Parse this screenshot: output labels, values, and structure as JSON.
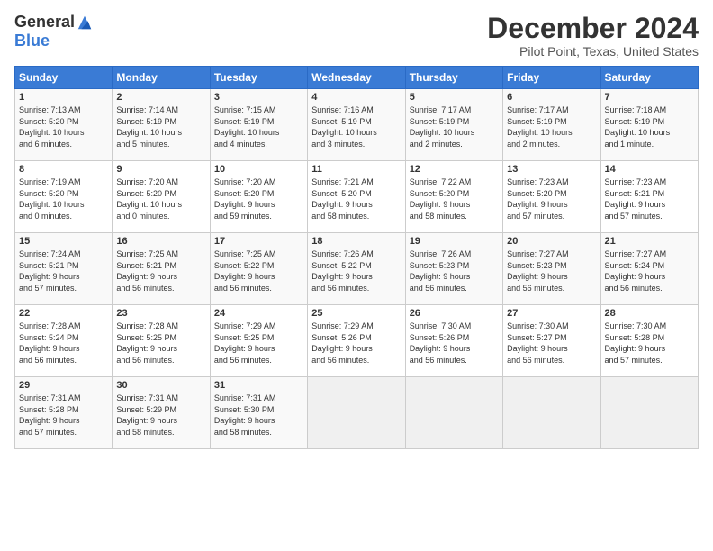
{
  "logo": {
    "general": "General",
    "blue": "Blue"
  },
  "header": {
    "month": "December 2024",
    "location": "Pilot Point, Texas, United States"
  },
  "weekdays": [
    "Sunday",
    "Monday",
    "Tuesday",
    "Wednesday",
    "Thursday",
    "Friday",
    "Saturday"
  ],
  "weeks": [
    [
      {
        "day": "1",
        "info": "Sunrise: 7:13 AM\nSunset: 5:20 PM\nDaylight: 10 hours\nand 6 minutes."
      },
      {
        "day": "2",
        "info": "Sunrise: 7:14 AM\nSunset: 5:19 PM\nDaylight: 10 hours\nand 5 minutes."
      },
      {
        "day": "3",
        "info": "Sunrise: 7:15 AM\nSunset: 5:19 PM\nDaylight: 10 hours\nand 4 minutes."
      },
      {
        "day": "4",
        "info": "Sunrise: 7:16 AM\nSunset: 5:19 PM\nDaylight: 10 hours\nand 3 minutes."
      },
      {
        "day": "5",
        "info": "Sunrise: 7:17 AM\nSunset: 5:19 PM\nDaylight: 10 hours\nand 2 minutes."
      },
      {
        "day": "6",
        "info": "Sunrise: 7:17 AM\nSunset: 5:19 PM\nDaylight: 10 hours\nand 2 minutes."
      },
      {
        "day": "7",
        "info": "Sunrise: 7:18 AM\nSunset: 5:19 PM\nDaylight: 10 hours\nand 1 minute."
      }
    ],
    [
      {
        "day": "8",
        "info": "Sunrise: 7:19 AM\nSunset: 5:20 PM\nDaylight: 10 hours\nand 0 minutes."
      },
      {
        "day": "9",
        "info": "Sunrise: 7:20 AM\nSunset: 5:20 PM\nDaylight: 10 hours\nand 0 minutes."
      },
      {
        "day": "10",
        "info": "Sunrise: 7:20 AM\nSunset: 5:20 PM\nDaylight: 9 hours\nand 59 minutes."
      },
      {
        "day": "11",
        "info": "Sunrise: 7:21 AM\nSunset: 5:20 PM\nDaylight: 9 hours\nand 58 minutes."
      },
      {
        "day": "12",
        "info": "Sunrise: 7:22 AM\nSunset: 5:20 PM\nDaylight: 9 hours\nand 58 minutes."
      },
      {
        "day": "13",
        "info": "Sunrise: 7:23 AM\nSunset: 5:20 PM\nDaylight: 9 hours\nand 57 minutes."
      },
      {
        "day": "14",
        "info": "Sunrise: 7:23 AM\nSunset: 5:21 PM\nDaylight: 9 hours\nand 57 minutes."
      }
    ],
    [
      {
        "day": "15",
        "info": "Sunrise: 7:24 AM\nSunset: 5:21 PM\nDaylight: 9 hours\nand 57 minutes."
      },
      {
        "day": "16",
        "info": "Sunrise: 7:25 AM\nSunset: 5:21 PM\nDaylight: 9 hours\nand 56 minutes."
      },
      {
        "day": "17",
        "info": "Sunrise: 7:25 AM\nSunset: 5:22 PM\nDaylight: 9 hours\nand 56 minutes."
      },
      {
        "day": "18",
        "info": "Sunrise: 7:26 AM\nSunset: 5:22 PM\nDaylight: 9 hours\nand 56 minutes."
      },
      {
        "day": "19",
        "info": "Sunrise: 7:26 AM\nSunset: 5:23 PM\nDaylight: 9 hours\nand 56 minutes."
      },
      {
        "day": "20",
        "info": "Sunrise: 7:27 AM\nSunset: 5:23 PM\nDaylight: 9 hours\nand 56 minutes."
      },
      {
        "day": "21",
        "info": "Sunrise: 7:27 AM\nSunset: 5:24 PM\nDaylight: 9 hours\nand 56 minutes."
      }
    ],
    [
      {
        "day": "22",
        "info": "Sunrise: 7:28 AM\nSunset: 5:24 PM\nDaylight: 9 hours\nand 56 minutes."
      },
      {
        "day": "23",
        "info": "Sunrise: 7:28 AM\nSunset: 5:25 PM\nDaylight: 9 hours\nand 56 minutes."
      },
      {
        "day": "24",
        "info": "Sunrise: 7:29 AM\nSunset: 5:25 PM\nDaylight: 9 hours\nand 56 minutes."
      },
      {
        "day": "25",
        "info": "Sunrise: 7:29 AM\nSunset: 5:26 PM\nDaylight: 9 hours\nand 56 minutes."
      },
      {
        "day": "26",
        "info": "Sunrise: 7:30 AM\nSunset: 5:26 PM\nDaylight: 9 hours\nand 56 minutes."
      },
      {
        "day": "27",
        "info": "Sunrise: 7:30 AM\nSunset: 5:27 PM\nDaylight: 9 hours\nand 56 minutes."
      },
      {
        "day": "28",
        "info": "Sunrise: 7:30 AM\nSunset: 5:28 PM\nDaylight: 9 hours\nand 57 minutes."
      }
    ],
    [
      {
        "day": "29",
        "info": "Sunrise: 7:31 AM\nSunset: 5:28 PM\nDaylight: 9 hours\nand 57 minutes."
      },
      {
        "day": "30",
        "info": "Sunrise: 7:31 AM\nSunset: 5:29 PM\nDaylight: 9 hours\nand 58 minutes."
      },
      {
        "day": "31",
        "info": "Sunrise: 7:31 AM\nSunset: 5:30 PM\nDaylight: 9 hours\nand 58 minutes."
      },
      {
        "day": "",
        "info": ""
      },
      {
        "day": "",
        "info": ""
      },
      {
        "day": "",
        "info": ""
      },
      {
        "day": "",
        "info": ""
      }
    ]
  ]
}
